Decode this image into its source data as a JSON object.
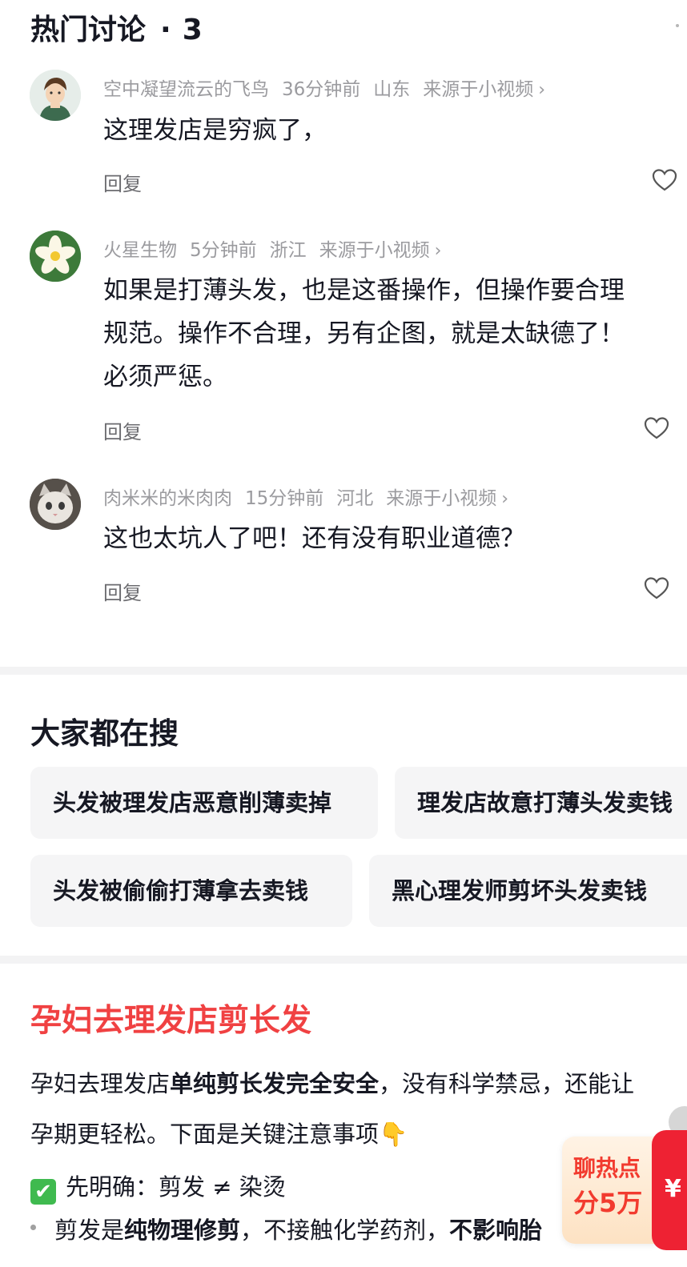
{
  "header": {
    "title": "热门讨论",
    "separator": "·",
    "count": "3"
  },
  "comments": [
    {
      "username": "空中凝望流云的飞鸟",
      "time": "36分钟前",
      "location": "山东",
      "source": "来源于小视频",
      "chevron": "›",
      "lines": [
        "这理发店是穷疯了，"
      ],
      "reply": "回复",
      "avatar_icon": "cartoon-boy-avatar"
    },
    {
      "username": "火星生物",
      "time": "5分钟前",
      "location": "浙江",
      "source": "来源于小视频",
      "chevron": "›",
      "lines": [
        "如果是打薄头发，也是这番操作，但操作要合理",
        "规范。操作不合理，另有企图，就是太缺德了！",
        "必须严惩。"
      ],
      "reply": "回复",
      "avatar_icon": "flower-avatar"
    },
    {
      "username": "肉米米的米肉肉",
      "time": "15分钟前",
      "location": "河北",
      "source": "来源于小视频",
      "chevron": "›",
      "lines": [
        "这也太坑人了吧！还有没有职业道德？"
      ],
      "reply": "回复",
      "avatar_icon": "cat-avatar"
    }
  ],
  "search": {
    "title": "大家都在搜",
    "chips": [
      "头发被理发店恶意削薄卖掉",
      "理发店故意打薄头发卖钱",
      "头发被偷偷打薄拿去卖钱",
      "黑心理发师剪坏头发卖钱"
    ]
  },
  "article": {
    "title": "孕妇去理发店剪长发",
    "p1_a": "孕妇去理发店",
    "p1_b": "单纯剪长发完全安全",
    "p1_c": "，没有科学禁忌，还能让",
    "p2": "孕期更轻松。下面是关键注意事项",
    "p2_emoji": "👇",
    "check_emoji": "✔",
    "p3": "先明确：剪发 ≠ 染烫",
    "p4_a": "剪发是",
    "p4_b": "纯物理修剪",
    "p4_c": "，不接触化学药剂，",
    "p4_d": "不影响胎"
  },
  "hot_badge": {
    "line1": "聊热点",
    "line2": "分5万",
    "symbol": "¥"
  },
  "colors": {
    "accent_red": "#f04142",
    "chip_bg": "#f5f5f6",
    "meta_gray": "#9b9b9f",
    "check_green": "#3fba4f"
  }
}
